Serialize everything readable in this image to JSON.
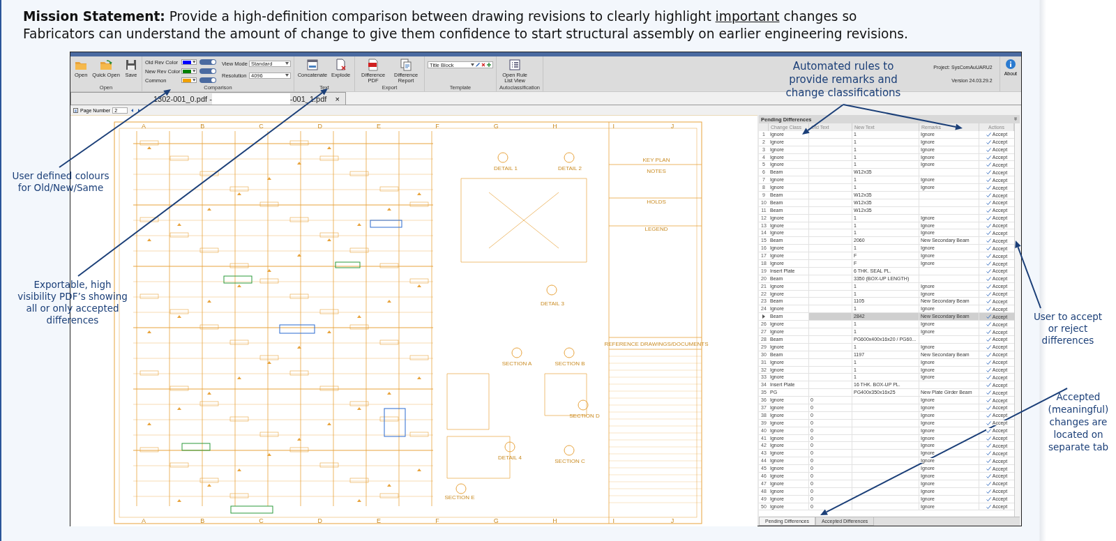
{
  "statement": {
    "lead": "Mission Statement:",
    "before": "Provide a high-definition comparison between drawing revisions to clearly highlight",
    "underlined": "important",
    "after": "changes so",
    "line2": "Fabricators can understand the amount of change to give them confidence to start structural assembly on earlier engineering revisions."
  },
  "annotations": [
    {
      "text": "Automated rules to provide remarks and change classifications"
    },
    {
      "text": "User defined colours for Old/New/Same"
    },
    {
      "text": "Exportable, high visibility PDF’s showing all or only accepted differences"
    },
    {
      "text": "User to accept or reject differences"
    },
    {
      "text": "Accepted (meaningful) changes are located on separate tab"
    }
  ],
  "ribbon": {
    "groups": [
      {
        "label": "Open",
        "kind": "buttons",
        "buttons": [
          "Open",
          "Quick Open",
          "Save"
        ]
      },
      {
        "label": "Comparison",
        "kind": "comparison",
        "colors": [
          {
            "label": "Old Rev Color",
            "color": "#0000ff",
            "on": true
          },
          {
            "label": "New Rev Color",
            "color": "#008000",
            "on": true
          },
          {
            "label": "Common",
            "color": "#f0a000",
            "on": true
          }
        ],
        "view_mode": {
          "label": "View Mode",
          "value": "Standard"
        },
        "resolution": {
          "label": "Resolution",
          "value": "4096"
        }
      },
      {
        "label": "Text",
        "kind": "buttons",
        "buttons": [
          "Concatenate",
          "Explode"
        ]
      },
      {
        "label": "Export",
        "kind": "buttons",
        "buttons": [
          "Difference PDF",
          "Difference Report"
        ]
      },
      {
        "label": "Template",
        "kind": "template",
        "value": "Title Block"
      },
      {
        "label": "Autoclassification",
        "kind": "buttons",
        "buttons": [
          "Open Rule List View"
        ]
      }
    ],
    "project": "Project: SysComAuUARU2",
    "version": "Version 24.03.29.2",
    "about": "About"
  },
  "document_tab": {
    "before": "1302-001_0.pdf -",
    "after": "-001_1.pdf",
    "close": "×"
  },
  "page_toolbar": {
    "label": "Page Number",
    "value": "2"
  },
  "drawing": {
    "grid_columns_top": [
      "A",
      "B",
      "C",
      "D",
      "E",
      "F",
      "G",
      "H",
      "I",
      "J"
    ],
    "grid_columns_bottom": [
      "A",
      "B",
      "C",
      "D",
      "E",
      "F",
      "G",
      "H",
      "I",
      "J"
    ],
    "labels": [
      "KEY PLAN",
      "NOTES",
      "HOLDS",
      "LEGEND",
      "REFERENCE DRAWINGS/DOCUMENTS",
      "DETAIL 1",
      "DETAIL 2",
      "DETAIL 3",
      "SECTION A",
      "SECTION B",
      "SECTION D",
      "DETAIL 4",
      "SECTION C",
      "SECTION E"
    ]
  },
  "panel": {
    "title": "Pending Differences",
    "columns": [
      "Change Class",
      "Old Text",
      "New Text",
      "Remarks",
      "Actions"
    ],
    "rows": [
      {
        "n": "1",
        "change_class": "Ignore",
        "new_text": "1",
        "remarks": "Ignore",
        "action": "Accept",
        "selected": false
      },
      {
        "n": "2",
        "change_class": "Ignore",
        "new_text": "1",
        "remarks": "Ignore",
        "action": "Accept",
        "selected": false
      },
      {
        "n": "3",
        "change_class": "Ignore",
        "new_text": "1",
        "remarks": "Ignore",
        "action": "Accept",
        "selected": false
      },
      {
        "n": "4",
        "change_class": "Ignore",
        "new_text": "1",
        "remarks": "Ignore",
        "action": "Accept",
        "selected": false
      },
      {
        "n": "5",
        "change_class": "Ignore",
        "new_text": "1",
        "remarks": "Ignore",
        "action": "Accept",
        "selected": false
      },
      {
        "n": "6",
        "change_class": "Beam",
        "new_text": "W12x35",
        "action": "Accept",
        "selected": false
      },
      {
        "n": "7",
        "change_class": "Ignore",
        "new_text": "1",
        "remarks": "Ignore",
        "action": "Accept",
        "selected": false
      },
      {
        "n": "8",
        "change_class": "Ignore",
        "new_text": "1",
        "remarks": "Ignore",
        "action": "Accept",
        "selected": false
      },
      {
        "n": "9",
        "change_class": "Beam",
        "new_text": "W12x35",
        "action": "Accept",
        "selected": false
      },
      {
        "n": "10",
        "change_class": "Beam",
        "new_text": "W12x35",
        "action": "Accept",
        "selected": false
      },
      {
        "n": "11",
        "change_class": "Beam",
        "new_text": "W12x35",
        "action": "Accept",
        "selected": false
      },
      {
        "n": "12",
        "change_class": "Ignore",
        "new_text": "1",
        "remarks": "Ignore",
        "action": "Accept",
        "selected": false
      },
      {
        "n": "13",
        "change_class": "Ignore",
        "new_text": "1",
        "remarks": "Ignore",
        "action": "Accept",
        "selected": false
      },
      {
        "n": "14",
        "change_class": "Ignore",
        "new_text": "1",
        "remarks": "Ignore",
        "action": "Accept",
        "selected": false
      },
      {
        "n": "15",
        "change_class": "Beam",
        "new_text": "2060",
        "remarks": "New Secondary Beam",
        "action": "Accept",
        "selected": false
      },
      {
        "n": "16",
        "change_class": "Ignore",
        "new_text": "1",
        "remarks": "Ignore",
        "action": "Accept",
        "selected": false
      },
      {
        "n": "17",
        "change_class": "Ignore",
        "new_text": "F",
        "remarks": "Ignore",
        "action": "Accept",
        "selected": false
      },
      {
        "n": "18",
        "change_class": "Ignore",
        "new_text": "F",
        "remarks": "Ignore",
        "action": "Accept",
        "selected": false
      },
      {
        "n": "19",
        "change_class": "Insert Plate",
        "new_text": "6 THK. SEAL PL.",
        "action": "Accept",
        "selected": false
      },
      {
        "n": "20",
        "change_class": "Beam",
        "new_text": "3350 (BOX-UP LENGTH)",
        "action": "Accept",
        "selected": false
      },
      {
        "n": "21",
        "change_class": "Ignore",
        "new_text": "1",
        "remarks": "Ignore",
        "action": "Accept",
        "selected": false
      },
      {
        "n": "22",
        "change_class": "Ignore",
        "new_text": "1",
        "remarks": "Ignore",
        "action": "Accept",
        "selected": false
      },
      {
        "n": "23",
        "change_class": "Beam",
        "new_text": "1105",
        "remarks": "New Secondary Beam",
        "action": "Accept",
        "selected": false
      },
      {
        "n": "24",
        "change_class": "Ignore",
        "new_text": "1",
        "remarks": "Ignore",
        "action": "Accept",
        "selected": false
      },
      {
        "change_class": "Beam",
        "new_text": "2842",
        "remarks": "New Secondary Beam",
        "action": "Accept",
        "selected": true
      },
      {
        "n": "26",
        "change_class": "Ignore",
        "new_text": "1",
        "remarks": "Ignore",
        "action": "Accept",
        "selected": false
      },
      {
        "n": "27",
        "change_class": "Ignore",
        "new_text": "1",
        "remarks": "Ignore",
        "action": "Accept",
        "selected": false
      },
      {
        "n": "28",
        "change_class": "Beam",
        "new_text": "PG600x400x16x20 / PG60...",
        "action": "Accept",
        "selected": false
      },
      {
        "n": "29",
        "change_class": "Ignore",
        "new_text": "1",
        "remarks": "Ignore",
        "action": "Accept",
        "selected": false
      },
      {
        "n": "30",
        "change_class": "Beam",
        "new_text": "1197",
        "remarks": "New Secondary Beam",
        "action": "Accept",
        "selected": false
      },
      {
        "n": "31",
        "change_class": "Ignore",
        "new_text": "1",
        "remarks": "Ignore",
        "action": "Accept",
        "selected": false
      },
      {
        "n": "32",
        "change_class": "Ignore",
        "new_text": "1",
        "remarks": "Ignore",
        "action": "Accept",
        "selected": false
      },
      {
        "n": "33",
        "change_class": "Ignore",
        "new_text": "1",
        "remarks": "Ignore",
        "action": "Accept",
        "selected": false
      },
      {
        "n": "34",
        "change_class": "Insert Plate",
        "new_text": "16 THK. BOX-UP PL.",
        "action": "Accept",
        "selected": false
      },
      {
        "n": "35",
        "change_class": "PG",
        "new_text": "PG400x350x16x25",
        "remarks": "New Plate Girder Beam",
        "action": "Accept",
        "selected": false
      },
      {
        "n": "36",
        "change_class": "Ignore",
        "old_text": "0",
        "remarks": "Ignore",
        "action": "Accept",
        "selected": false
      },
      {
        "n": "37",
        "change_class": "Ignore",
        "old_text": "0",
        "remarks": "Ignore",
        "action": "Accept",
        "selected": false
      },
      {
        "n": "38",
        "change_class": "Ignore",
        "old_text": "0",
        "remarks": "Ignore",
        "action": "Accept",
        "selected": false
      },
      {
        "n": "39",
        "change_class": "Ignore",
        "old_text": "0",
        "remarks": "Ignore",
        "action": "Accept",
        "selected": false
      },
      {
        "n": "40",
        "change_class": "Ignore",
        "old_text": "0",
        "remarks": "Ignore",
        "action": "Accept",
        "selected": false
      },
      {
        "n": "41",
        "change_class": "Ignore",
        "old_text": "0",
        "remarks": "Ignore",
        "action": "Accept",
        "selected": false
      },
      {
        "n": "42",
        "change_class": "Ignore",
        "old_text": "0",
        "remarks": "Ignore",
        "action": "Accept",
        "selected": false
      },
      {
        "n": "43",
        "change_class": "Ignore",
        "old_text": "0",
        "remarks": "Ignore",
        "action": "Accept",
        "selected": false
      },
      {
        "n": "44",
        "change_class": "Ignore",
        "old_text": "0",
        "remarks": "Ignore",
        "action": "Accept",
        "selected": false
      },
      {
        "n": "45",
        "change_class": "Ignore",
        "old_text": "0",
        "remarks": "Ignore",
        "action": "Accept",
        "selected": false
      },
      {
        "n": "46",
        "change_class": "Ignore",
        "old_text": "0",
        "remarks": "Ignore",
        "action": "Accept",
        "selected": false
      },
      {
        "n": "47",
        "change_class": "Ignore",
        "old_text": "0",
        "remarks": "Ignore",
        "action": "Accept",
        "selected": false
      },
      {
        "n": "48",
        "change_class": "Ignore",
        "old_text": "0",
        "remarks": "Ignore",
        "action": "Accept",
        "selected": false
      },
      {
        "n": "49",
        "change_class": "Ignore",
        "old_text": "0",
        "remarks": "Ignore",
        "action": "Accept",
        "selected": false
      },
      {
        "n": "50",
        "change_class": "Ignore",
        "old_text": "0",
        "remarks": "Ignore",
        "action": "Accept",
        "selected": false
      }
    ],
    "tabs": [
      {
        "label": "Pending Differences",
        "selected": true
      },
      {
        "label": "Accepted Differences",
        "selected": false
      }
    ]
  }
}
